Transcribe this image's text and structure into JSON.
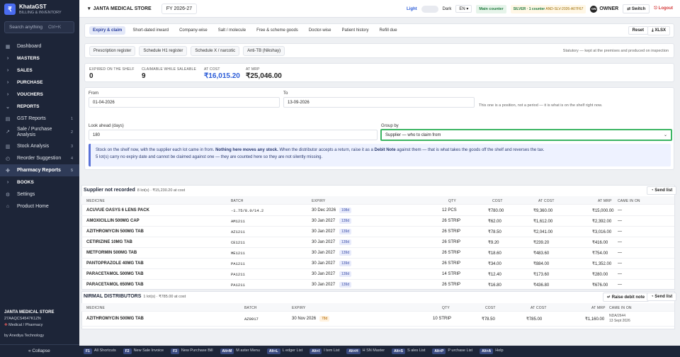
{
  "brand": {
    "name": "KhataGST",
    "sub": "BILLING & INVENTORY",
    "logo": "₹"
  },
  "search": {
    "placeholder": "Search anything",
    "shortcut": "Ctrl+K"
  },
  "nav": [
    {
      "label": "Dashboard",
      "icon": "▦",
      "num": ""
    },
    {
      "label": "MASTERS",
      "icon": "›",
      "num": ""
    },
    {
      "label": "SALES",
      "icon": "›",
      "num": ""
    },
    {
      "label": "PURCHASE",
      "icon": "›",
      "num": ""
    },
    {
      "label": "VOUCHERS",
      "icon": "›",
      "num": ""
    },
    {
      "label": "REPORTS",
      "icon": "⌄",
      "num": ""
    },
    {
      "label": "GST Reports",
      "icon": "▤",
      "num": "1"
    },
    {
      "label": "Sale / Purchase Analysis",
      "icon": "↗",
      "num": "2"
    },
    {
      "label": "Stock Analysis",
      "icon": "▥",
      "num": "3"
    },
    {
      "label": "Reorder Suggestion",
      "icon": "◴",
      "num": "4"
    },
    {
      "label": "Pharmacy Reports",
      "icon": "✚",
      "num": "5"
    },
    {
      "label": "BOOKS",
      "icon": "›",
      "num": ""
    },
    {
      "label": "Settings",
      "icon": "⚙",
      "num": ""
    },
    {
      "label": "Product Home",
      "icon": "⌂",
      "num": ""
    }
  ],
  "footer": {
    "company": "JANTA MEDICAL STORE",
    "gstin": "27AAQCS4547K1ZN",
    "type": "Medical / Pharmacy",
    "by": "by Anediya Technology",
    "collapse": "« Collapse"
  },
  "topbar": {
    "store": "JANTA MEDICAL STORE",
    "fy": "FY 2026-27",
    "light": "Light",
    "dark": "Dark",
    "lang": "EN",
    "counter": "Main counter",
    "license_tier": "SILVER · 1 counter",
    "license_code": "AND-SLV-2026-A07F67",
    "owner_initials": "ON",
    "owner": "OWNER",
    "switch": "Switch",
    "logout": "Logout"
  },
  "tabs": [
    "Expiry & claim",
    "Short-dated inward",
    "Company-wise",
    "Salt / molecule",
    "Free & scheme goods",
    "Doctor-wise",
    "Patient history",
    "Refill due"
  ],
  "tab_actions": {
    "reset": "Reset",
    "xlsx": "XLSX"
  },
  "subtabs": [
    "Prescription register",
    "Schedule H1 register",
    "Schedule X / narcotic",
    "Anti-TB (Nikshay)"
  ],
  "subtab_note": "Statutory — kept at the premises and produced on inspection",
  "stats": [
    {
      "label": "EXPIRED ON THE SHELF",
      "value": "0"
    },
    {
      "label": "CLAIMABLE WHILE SALEABLE",
      "value": "9"
    },
    {
      "label": "AT COST",
      "value": "₹16,015.20"
    },
    {
      "label": "AT MRP",
      "value": "₹25,046.00"
    }
  ],
  "filters": {
    "from_label": "From",
    "from": "01-04-2026",
    "to_label": "To",
    "to": "13-09-2026",
    "to_hint": "This one is a position, not a period — it is what is on the shelf right now.",
    "ahead_label": "Look ahead (days)",
    "ahead": "180",
    "group_label": "Group by",
    "group": "Supplier — who to claim from"
  },
  "info": {
    "line1a": "Stock on the shelf now, with the supplier each lot came in from.",
    "line1b": "Nothing here moves any stock.",
    "line1c": "When the distributor accepts a return, raise it as a",
    "line1d": "Debit Note",
    "line1e": "against them — that is what takes the goods off the shelf and reverses the tax.",
    "line2": "5 lot(s) carry no expiry date and cannot be claimed against one — they are counted here so they are not silently missing."
  },
  "group1": {
    "title": "Supplier not recorded",
    "meta": "8 lot(s) · ₹15,230.20 at cost",
    "send": "Send list",
    "cols": [
      "MEDICINE",
      "BATCH",
      "EXPIRY",
      "QTY",
      "COST",
      "AT COST",
      "AT MRP",
      "CAME IN ON"
    ],
    "rows": [
      {
        "medicine": "ACUVUE OASYS 6 LENS PACK",
        "batch": "-1.75/8.0/14.2",
        "expiry": "30 Dec 2026",
        "days": "108d",
        "qty": "12 PCS",
        "cost": "₹780.00",
        "at_cost": "₹9,360.00",
        "at_mrp": "₹15,000.00",
        "came": "—"
      },
      {
        "medicine": "AMOXICILLIN 500MG CAP",
        "batch": "AM1211",
        "expiry": "30 Jan 2027",
        "days": "139d",
        "qty": "26 STRIP",
        "cost": "₹62.00",
        "at_cost": "₹1,612.00",
        "at_mrp": "₹2,392.00",
        "came": "—"
      },
      {
        "medicine": "AZITHROMYCIN 500MG TAB",
        "batch": "AZ1211",
        "expiry": "30 Jan 2027",
        "days": "139d",
        "qty": "26 STRIP",
        "cost": "₹78.50",
        "at_cost": "₹2,041.00",
        "at_mrp": "₹3,016.00",
        "came": "—"
      },
      {
        "medicine": "CETIRIZINE 10MG TAB",
        "batch": "CE1211",
        "expiry": "30 Jan 2027",
        "days": "139d",
        "qty": "26 STRIP",
        "cost": "₹9.20",
        "at_cost": "₹239.20",
        "at_mrp": "₹416.00",
        "came": "—"
      },
      {
        "medicine": "METFORMIN 500MG TAB",
        "batch": "ME1211",
        "expiry": "30 Jan 2027",
        "days": "139d",
        "qty": "26 STRIP",
        "cost": "₹18.60",
        "at_cost": "₹483.60",
        "at_mrp": "₹754.00",
        "came": "—"
      },
      {
        "medicine": "PANTOPRAZOLE 40MG TAB",
        "batch": "PA1211",
        "expiry": "30 Jan 2027",
        "days": "139d",
        "qty": "26 STRIP",
        "cost": "₹34.00",
        "at_cost": "₹884.00",
        "at_mrp": "₹1,352.00",
        "came": "—"
      },
      {
        "medicine": "PARACETAMOL 500MG TAB",
        "batch": "PA1211",
        "expiry": "30 Jan 2027",
        "days": "139d",
        "qty": "14 STRIP",
        "cost": "₹12.40",
        "at_cost": "₹173.60",
        "at_mrp": "₹280.00",
        "came": "—"
      },
      {
        "medicine": "PARACETAMOL 650MG TAB",
        "batch": "PA1211",
        "expiry": "30 Jan 2027",
        "days": "139d",
        "qty": "26 STRIP",
        "cost": "₹16.80",
        "at_cost": "₹436.80",
        "at_mrp": "₹676.00",
        "came": "—"
      }
    ]
  },
  "group2": {
    "title": "NIRMAL DISTRIBUTORS",
    "meta": "1 lot(s) · ₹785.00 at cost",
    "debit": "Raise debit note",
    "send": "Send list",
    "cols": [
      "MEDICINE",
      "BATCH",
      "EXPIRY",
      "QTY",
      "COST",
      "AT COST",
      "AT MRP",
      "CAME IN ON"
    ],
    "rows": [
      {
        "medicine": "AZITHROMYCIN 500MG TAB",
        "batch": "AZ0917",
        "expiry": "30 Nov 2026",
        "days": "78d",
        "qty": "10 STRIP",
        "cost": "₹78.50",
        "at_cost": "₹785.00",
        "at_mrp": "₹1,160.00",
        "came1": "NDA/2644",
        "came2": "13 Sept 2026"
      }
    ]
  },
  "shortcuts": [
    {
      "k": "F1",
      "t": "All Shortcuts"
    },
    {
      "k": "F2",
      "t": "New Sale Invoice"
    },
    {
      "k": "F3",
      "t": "New Purchase Bill"
    },
    {
      "k": "Alt+M",
      "t": "M aster Menu"
    },
    {
      "k": "Alt+L",
      "t": "L edger List"
    },
    {
      "k": "Alt+I",
      "t": "I tem List"
    },
    {
      "k": "Alt+H",
      "t": "H SN Master"
    },
    {
      "k": "Alt+S",
      "t": "S ales List"
    },
    {
      "k": "Alt+P",
      "t": "P urchase List"
    },
    {
      "k": "Alt+A",
      "t": "Help"
    }
  ]
}
